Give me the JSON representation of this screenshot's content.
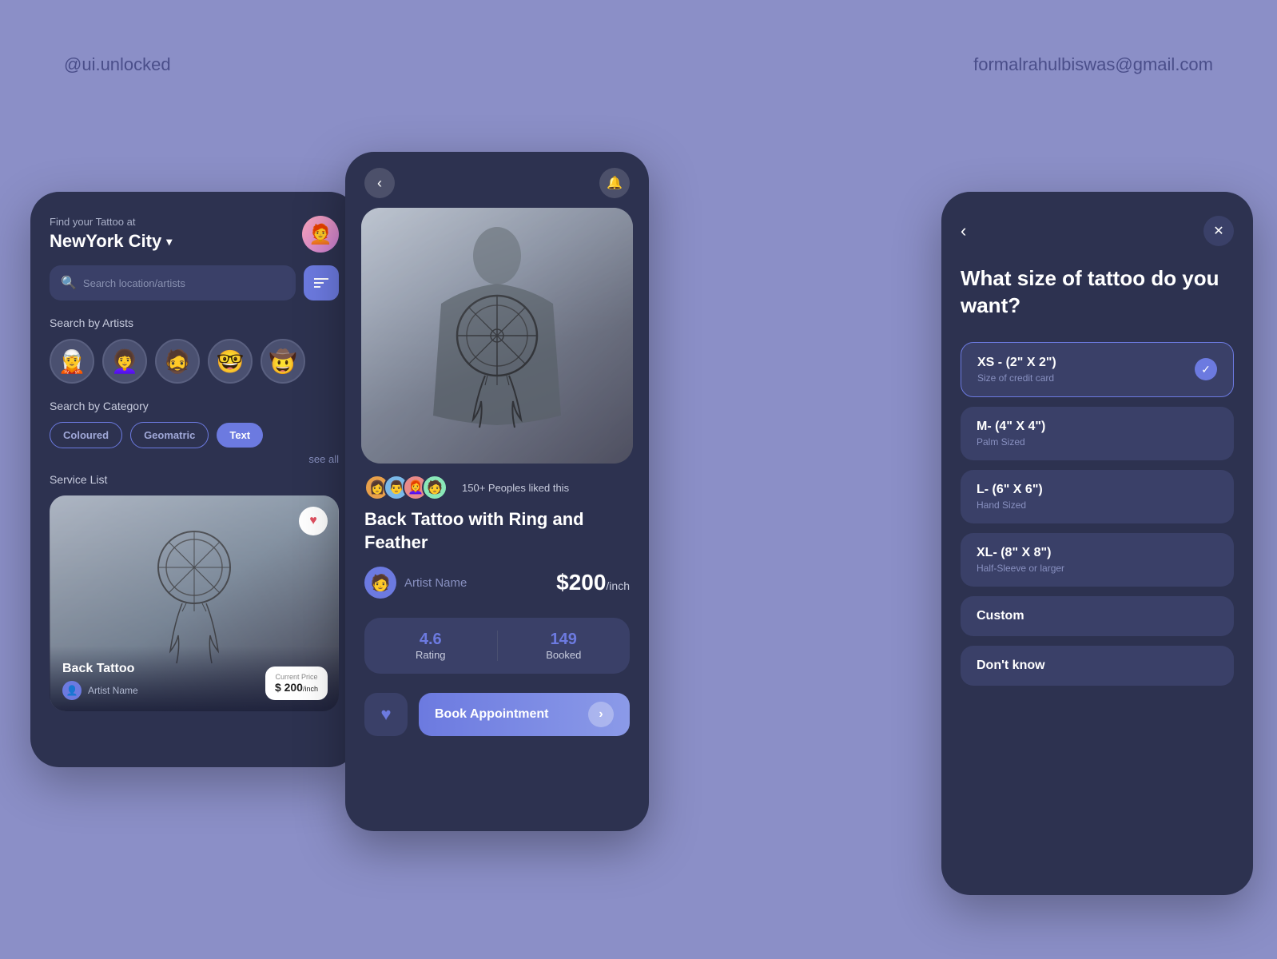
{
  "page": {
    "background": "#8b8fc7",
    "watermark_left": "@ui.unlocked",
    "watermark_right": "formalrahulbiswas@gmail.com"
  },
  "screen1": {
    "find_text": "Find your Tattoo at",
    "city": "NewYork City",
    "search_placeholder": "Search location/artists",
    "search_by_artists_label": "Search by Artists",
    "search_by_category_label": "Search by Category",
    "categories": [
      {
        "label": "Coloured",
        "type": "outline"
      },
      {
        "label": "Geomatric",
        "type": "outline"
      },
      {
        "label": "Text",
        "type": "filled"
      }
    ],
    "see_all": "see all",
    "service_list_label": "Service List",
    "card": {
      "title": "Back Tattoo",
      "artist_name": "Artist Name",
      "current_price_label": "Current Price",
      "price": "$ 200",
      "price_unit": "/inch"
    }
  },
  "screen2": {
    "tattoo_title": "Back Tattoo with Ring and\nFeather",
    "likes_text": "150+ Peoples liked this",
    "artist_name": "Artist Name",
    "price": "$200",
    "price_unit": "/inch",
    "rating_value": "4.6",
    "rating_label": "Rating",
    "booked_value": "149",
    "booked_label": "Booked",
    "book_btn": "Book Appointment"
  },
  "screen3": {
    "title": "What size of tattoo\ndo you want?",
    "options": [
      {
        "id": "xs",
        "name": "XS - (2\" X 2\")",
        "desc": "Size of credit card",
        "selected": true
      },
      {
        "id": "m",
        "name": "M- (4\" X 4\")",
        "desc": "Palm Sized",
        "selected": false
      },
      {
        "id": "l",
        "name": "L- (6\" X 6\")",
        "desc": "Hand Sized",
        "selected": false
      },
      {
        "id": "xl",
        "name": "XL- (8\" X 8\")",
        "desc": "Half-Sleeve or larger",
        "selected": false
      }
    ],
    "custom_label": "Custom",
    "dont_know_label": "Don't know"
  },
  "artists": [
    {
      "emoji": "🧝"
    },
    {
      "emoji": "👩‍🦱"
    },
    {
      "emoji": "🧔"
    },
    {
      "emoji": "🤓"
    },
    {
      "emoji": "🤠"
    }
  ],
  "like_avatars": [
    {
      "emoji": "👩"
    },
    {
      "emoji": "👨"
    },
    {
      "emoji": "👩‍🦰"
    },
    {
      "emoji": "🧑"
    }
  ]
}
